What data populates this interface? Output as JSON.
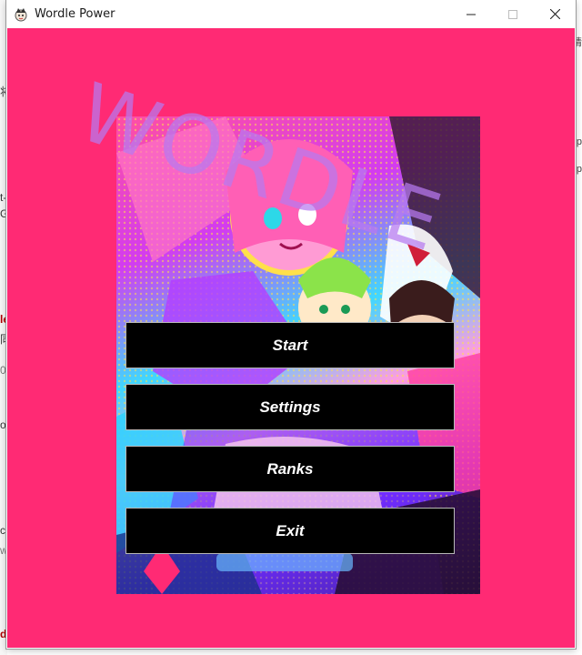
{
  "window": {
    "title": "Wordle Power",
    "controls": [
      "minimize",
      "maximize",
      "close"
    ]
  },
  "logo": {
    "text": "WORDLE"
  },
  "menu": {
    "start_label": "Start",
    "settings_label": "Settings",
    "ranks_label": "Ranks",
    "exit_label": "Exit"
  },
  "background_app": {
    "left_marks": [
      "将",
      "t-",
      "G",
      "le",
      "同",
      "0",
      "or",
      "c",
      "wo",
      "d"
    ],
    "right_marks": [
      "请",
      "p",
      "p"
    ]
  },
  "colors": {
    "client_background": "#ff2a74",
    "button_background": "#000000",
    "button_text": "#ffffff",
    "logo_color": "#b77af0"
  },
  "icons": {
    "app": "wordle-app-icon",
    "minimize": "minimize-icon",
    "maximize": "maximize-icon",
    "close": "close-icon"
  }
}
